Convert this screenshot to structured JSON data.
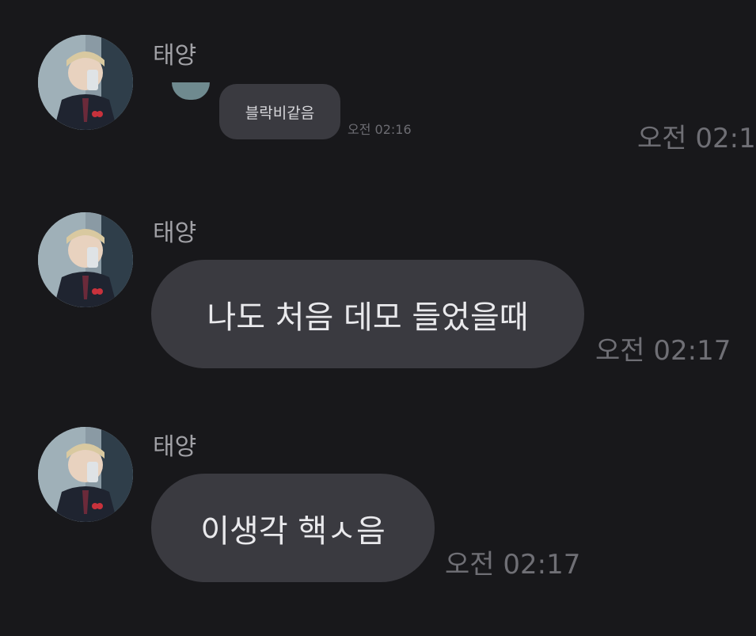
{
  "messages": [
    {
      "sender": "태양",
      "inner_text": "블락비같음",
      "inner_time": "오전 02:16",
      "time": "오전 02:1"
    },
    {
      "sender": "태양",
      "text": "나도 처음 데모 들었을때",
      "time": "오전 02:17"
    },
    {
      "sender": "태양",
      "text": "이생각 핵ㅅ음",
      "time": "오전 02:17"
    }
  ],
  "colors": {
    "background": "#18181b",
    "bubble": "#3a3a40",
    "sender_text": "#a1a1a6",
    "time_text": "#6f6f75",
    "message_text": "#e9e9ec"
  },
  "icons": {
    "avatar": "profile-photo"
  }
}
